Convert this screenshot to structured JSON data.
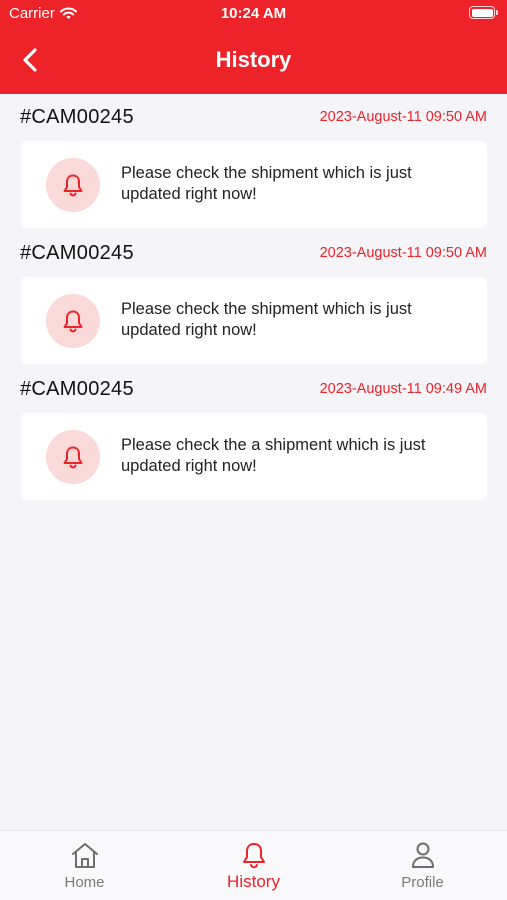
{
  "status_bar": {
    "carrier": "Carrier",
    "time": "10:24 AM"
  },
  "header": {
    "title": "History",
    "back_icon": "chevron-left-icon",
    "background": "#ee2229"
  },
  "notifications": [
    {
      "code": "#CAM00245",
      "date": "2023-August-11 09:50 AM",
      "message": "Please check the shipment which is just updated right now!",
      "icon": "bell-icon"
    },
    {
      "code": "#CAM00245",
      "date": "2023-August-11 09:50 AM",
      "message": "Please check the shipment which is just updated right now!",
      "icon": "bell-icon"
    },
    {
      "code": "#CAM00245",
      "date": "2023-August-11 09:49 AM",
      "message": "Please check the a shipment which is just updated right now!",
      "icon": "bell-icon"
    }
  ],
  "tab_bar": {
    "tabs": [
      {
        "label": "Home",
        "icon": "home-icon",
        "active": false
      },
      {
        "label": "History",
        "icon": "bell-icon",
        "active": true
      },
      {
        "label": "Profile",
        "icon": "user-icon",
        "active": false
      }
    ]
  },
  "colors": {
    "accent": "#ee2229",
    "icon_bg": "#fcd9d9",
    "page_bg": "#f5f5f9"
  }
}
